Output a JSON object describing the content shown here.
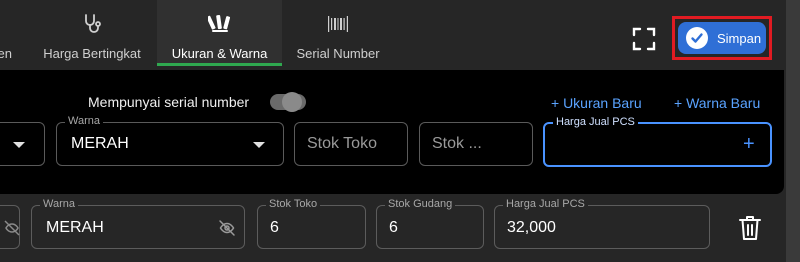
{
  "tabs": [
    {
      "label": "en",
      "icon": "unknown-icon",
      "active": false
    },
    {
      "label": "Harga Bertingkat",
      "icon": "stethoscope-icon",
      "active": false
    },
    {
      "label": "Ukuran & Warna",
      "icon": "color-swatch-icon",
      "active": true
    },
    {
      "label": "Serial Number",
      "icon": "barcode-icon",
      "active": false
    }
  ],
  "toolbar": {
    "fullscreen_icon": "fullscreen-icon",
    "save_label": "Simpan"
  },
  "form": {
    "serial_toggle_label": "Mempunyai serial number",
    "serial_toggle_on": false,
    "add_size_link": "+ Ukuran Baru",
    "add_color_link": "+ Warna Baru",
    "color_legend": "Warna",
    "color_value": "MERAH",
    "store_stock_placeholder": "Stok Toko",
    "warehouse_stock_placeholder": "Stok ...",
    "price_legend": "Harga Jual PCS",
    "price_value": ""
  },
  "variant_row": {
    "color_legend": "Warna",
    "color_value": "MERAH",
    "store_stock_legend": "Stok Toko",
    "store_stock_value": "6",
    "warehouse_stock_legend": "Stok Gudang",
    "warehouse_stock_value": "6",
    "price_legend": "Harga Jual PCS",
    "price_value": "32,000"
  },
  "colors": {
    "accent": "#2f6fd6",
    "active_tab_bar": "#2fa84f",
    "link": "#5aa3ff",
    "highlight_border": "#e11b22"
  }
}
